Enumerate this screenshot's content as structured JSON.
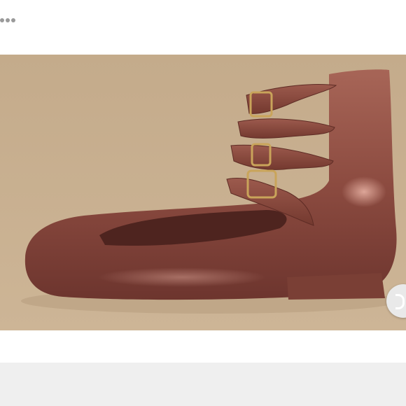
{
  "header": {
    "more_icon": "more-horizontal-icon"
  },
  "photo": {
    "subject": "shoe-photo"
  },
  "side_button": {
    "icon": "chevron-icon"
  },
  "colors": {
    "backdrop": "#c9b08f",
    "shoe": "#8a4a3f",
    "buckle": "#c9a45a",
    "bottom_bar": "#efefef"
  }
}
